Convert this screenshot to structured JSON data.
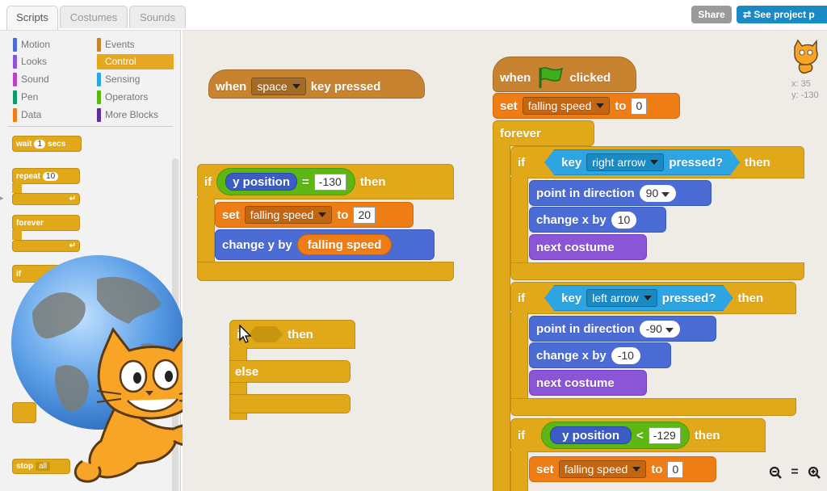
{
  "tabs": {
    "scripts": "Scripts",
    "costumes": "Costumes",
    "sounds": "Sounds"
  },
  "top": {
    "share": "Share",
    "see_project": "See project p"
  },
  "categories": {
    "motion": "Motion",
    "looks": "Looks",
    "sound": "Sound",
    "pen": "Pen",
    "data": "Data",
    "events": "Events",
    "control": "Control",
    "sensing": "Sensing",
    "operators": "Operators",
    "more": "More Blocks"
  },
  "palette": {
    "wait": "wait",
    "wait_val": "1",
    "secs": "secs",
    "repeat": "repeat",
    "repeat_val": "10",
    "forever": "forever",
    "if": "if",
    "stop": "stop",
    "stop_val": "all"
  },
  "sprite_info": {
    "x": "x: 35",
    "y": "y: -130"
  },
  "script1": {
    "when": "when",
    "key": "space",
    "key_pressed": "key pressed",
    "if": "if",
    "y_position": "y position",
    "equals": "=",
    "val": "-130",
    "then": "then",
    "set": "set",
    "var": "falling speed",
    "to": "to",
    "set_val": "20",
    "change_y": "change y by",
    "falling_speed": "falling  speed"
  },
  "script2": {
    "if": "if",
    "then": "then",
    "else": "else"
  },
  "script3": {
    "when": "when",
    "clicked": "clicked",
    "set": "set",
    "var": "falling speed",
    "to": "to",
    "set_val": "0",
    "forever": "forever",
    "if1": "if",
    "key1": "key",
    "key1_val": "right arrow",
    "pressed1": "pressed?",
    "then1": "then",
    "point1": "point  in  direction",
    "dir1": "90",
    "change1": "change  x  by",
    "chg1": "10",
    "next1": "next  costume",
    "if2": "if",
    "key2": "key",
    "key2_val": "left arrow",
    "pressed2": "pressed?",
    "then2": "then",
    "point2": "point  in  direction",
    "dir2": "-90",
    "change2": "change  x  by",
    "chg2": "-10",
    "next2": "next  costume",
    "if3": "if",
    "ypos": "y position",
    "lt": "<",
    "ycmp": "-129",
    "then3": "then",
    "set3": "set",
    "var3": "falling speed",
    "to3": "to",
    "set3_val": "0"
  },
  "zoom": {
    "out": "🔍",
    "reset": "=",
    "in": "🔍"
  },
  "colors": {
    "share": "#9a9a9a",
    "see_project": "#1a8ac4",
    "events": "#c88330",
    "control": "#e1a91a",
    "data": "#ee7d16",
    "motion": "#4a6cd4",
    "looks": "#8a55d7",
    "sensing": "#2ca5e2",
    "operators": "#5cb712"
  }
}
